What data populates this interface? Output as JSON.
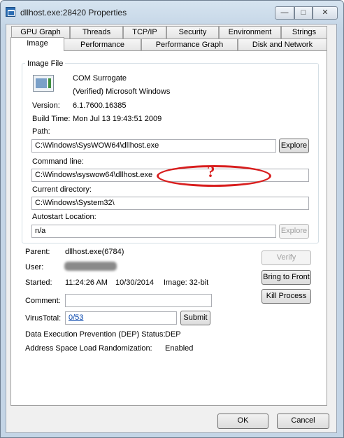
{
  "window": {
    "title": "dllhost.exe:28420 Properties",
    "minimize_glyph": "—",
    "maximize_glyph": "□",
    "close_glyph": "✕"
  },
  "tabs": {
    "row1": [
      "GPU Graph",
      "Threads",
      "TCP/IP",
      "Security",
      "Environment",
      "Strings"
    ],
    "row2": [
      "Image",
      "Performance",
      "Performance Graph",
      "Disk and Network"
    ],
    "active": "Image"
  },
  "image_file": {
    "group_label": "Image File",
    "description": "COM Surrogate",
    "company": "(Verified) Microsoft Windows",
    "version_label": "Version:",
    "version": "6.1.7600.16385",
    "build_time_label": "Build Time:",
    "build_time": "Mon Jul 13 19:43:51 2009",
    "path_label": "Path:",
    "path": "C:\\Windows\\SysWOW64\\dllhost.exe",
    "explore_label": "Explore",
    "command_line_label": "Command line:",
    "command_line": "C:\\Windows\\syswow64\\dllhost.exe",
    "annotation": "?",
    "current_dir_label": "Current directory:",
    "current_dir": "C:\\Windows\\System32\\",
    "autostart_label": "Autostart Location:",
    "autostart": "n/a",
    "autostart_explore_label": "Explore"
  },
  "process": {
    "parent_label": "Parent:",
    "parent": "dllhost.exe(6784)",
    "user_label": "User:",
    "started_label": "Started:",
    "started_time": "11:24:26 AM",
    "started_date": "10/30/2014",
    "image_bits": "Image: 32-bit",
    "comment_label": "Comment:",
    "comment": "",
    "virustotal_label": "VirusTotal:",
    "virustotal_value": "0/53",
    "submit_label": "Submit",
    "dep_label": "Data Execution Prevention (DEP) Status:",
    "dep_value": "DEP",
    "aslr_label": "Address Space Load Randomization:",
    "aslr_value": "Enabled"
  },
  "actions": {
    "verify": "Verify",
    "bring_to_front": "Bring to Front",
    "kill_process": "Kill Process"
  },
  "footer": {
    "ok": "OK",
    "cancel": "Cancel"
  },
  "colors": {
    "annotation_red": "#d81e1e",
    "link_blue": "#0645ad"
  },
  "icons": {
    "app_icon": "window-app-icon",
    "file_icon": "executable-file-icon"
  }
}
